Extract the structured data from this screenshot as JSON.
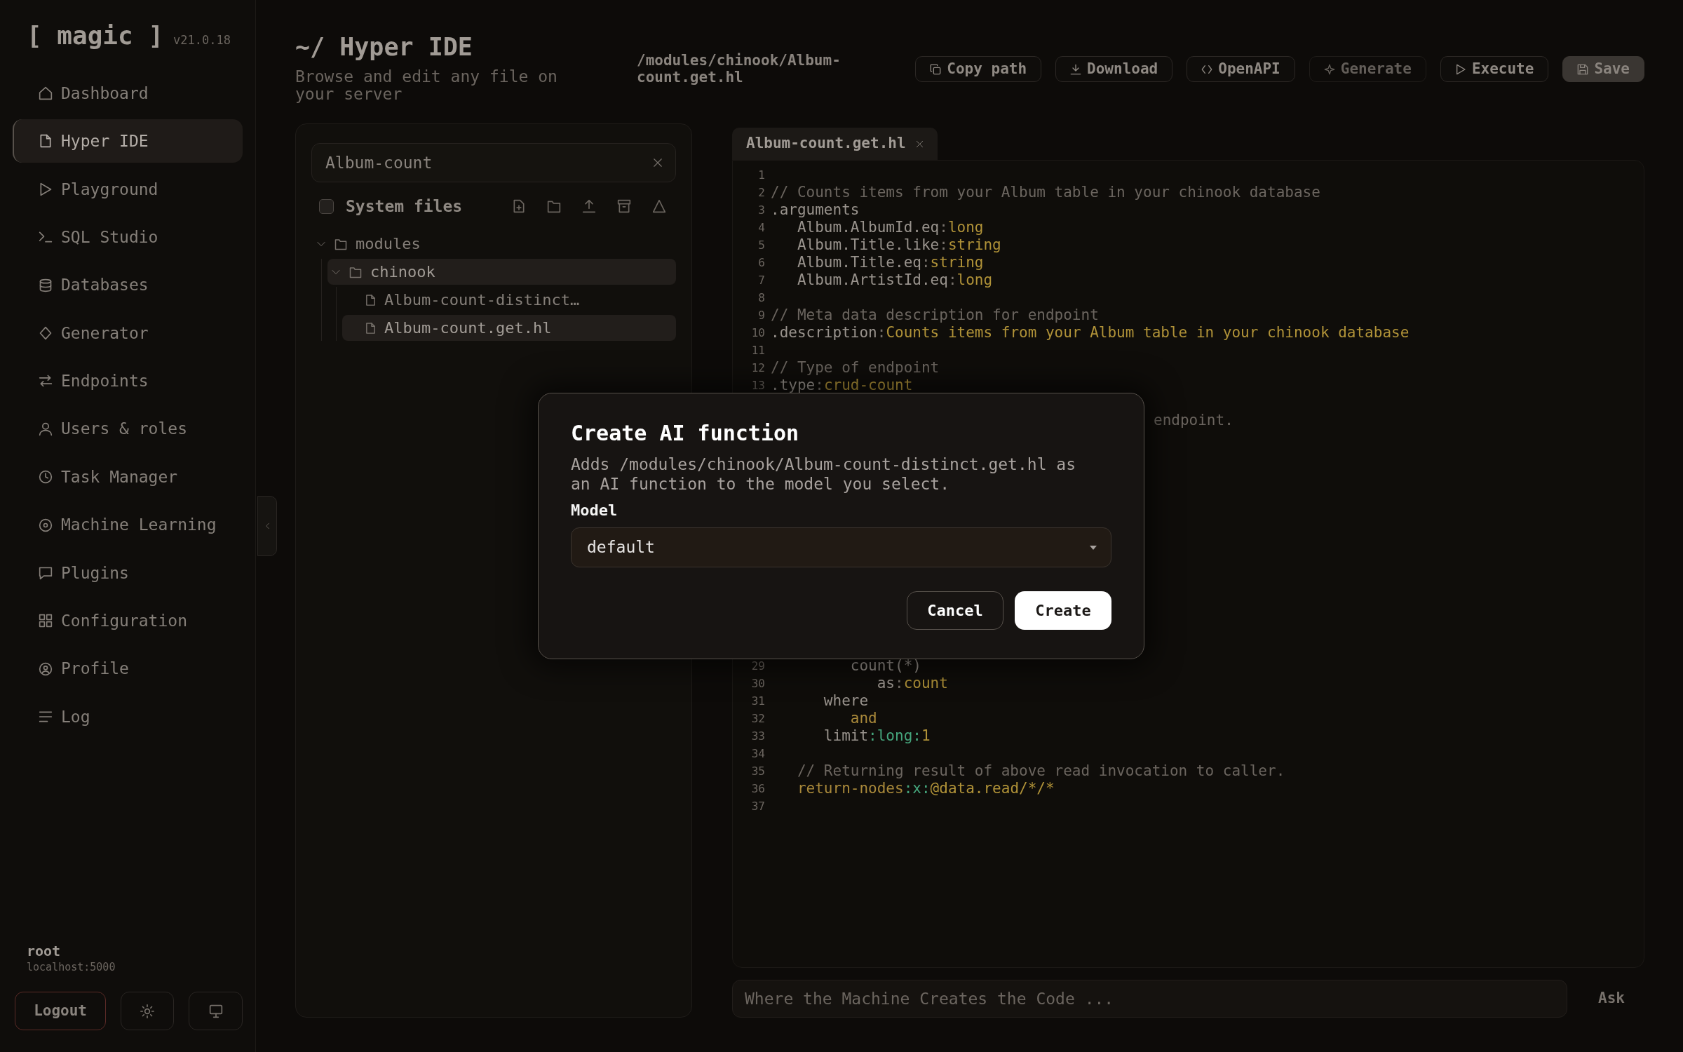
{
  "sidebar": {
    "logo": "[ magic ]",
    "version": "v21.0.18",
    "nav": [
      {
        "label": "Dashboard",
        "selected": false
      },
      {
        "label": "Hyper IDE",
        "selected": true
      },
      {
        "label": "Playground",
        "selected": false
      },
      {
        "label": "SQL Studio",
        "selected": false
      },
      {
        "label": "Databases",
        "selected": false
      },
      {
        "label": "Generator",
        "selected": false
      },
      {
        "label": "Endpoints",
        "selected": false
      },
      {
        "label": "Users & roles",
        "selected": false
      },
      {
        "label": "Task Manager",
        "selected": false
      },
      {
        "label": "Machine Learning",
        "selected": false
      },
      {
        "label": "Plugins",
        "selected": false
      },
      {
        "label": "Configuration",
        "selected": false
      },
      {
        "label": "Profile",
        "selected": false
      },
      {
        "label": "Log",
        "selected": false
      }
    ],
    "user": {
      "name": "root",
      "host": "localhost:5000"
    },
    "logout_button": "Logout"
  },
  "header": {
    "title": "~/ Hyper IDE",
    "subtitle": "Browse and edit any file on your server",
    "path": "/modules/chinook/Album-count.get.hl",
    "actions": [
      {
        "label": "Copy path",
        "kind": "outline",
        "disabled": false
      },
      {
        "label": "Download",
        "kind": "outline",
        "disabled": false
      },
      {
        "label": "OpenAPI",
        "kind": "outline",
        "disabled": false
      },
      {
        "label": "Generate",
        "kind": "outline",
        "disabled": true
      },
      {
        "label": "Execute",
        "kind": "outline",
        "disabled": false
      },
      {
        "label": "Save",
        "kind": "primary",
        "disabled": true
      }
    ]
  },
  "file_panel": {
    "search": {
      "value": "Album-count"
    },
    "system_files": {
      "label": "System files",
      "checked": false
    },
    "tree": [
      {
        "label": "modules",
        "kind": "folder",
        "expanded": true,
        "selected": false,
        "children": [
          {
            "label": "chinook",
            "kind": "folder",
            "expanded": true,
            "selected": true,
            "children": [
              {
                "label": "Album-count-distinct…",
                "kind": "file",
                "selected": false
              },
              {
                "label": "Album-count.get.hl",
                "kind": "file",
                "selected": true
              }
            ]
          }
        ]
      }
    ]
  },
  "editor": {
    "tabs": [
      {
        "label": "Album-count.get.hl",
        "selected": true
      }
    ],
    "lines_above": [
      {
        "number": "1"
      },
      {
        "number": "2",
        "segments": [
          {
            "text": "// Counts items from your Album table in your chinook database",
            "kind": "comment"
          }
        ]
      },
      {
        "number": "3",
        "segments": [
          {
            "text": ".arguments",
            "kind": "key"
          }
        ]
      },
      {
        "number": "4",
        "segments": [
          {
            "text": "   Album.AlbumId.eq",
            "kind": "key"
          },
          {
            "text": ":",
            "kind": "separator"
          },
          {
            "text": "long",
            "kind": "value"
          }
        ]
      },
      {
        "number": "5",
        "segments": [
          {
            "text": "   Album.Title.like",
            "kind": "key"
          },
          {
            "text": ":",
            "kind": "separator"
          },
          {
            "text": "string",
            "kind": "value"
          }
        ]
      },
      {
        "number": "6",
        "segments": [
          {
            "text": "   Album.Title.eq",
            "kind": "key"
          },
          {
            "text": ":",
            "kind": "separator"
          },
          {
            "text": "string",
            "kind": "value"
          }
        ]
      },
      {
        "number": "7",
        "segments": [
          {
            "text": "   Album.ArtistId.eq",
            "kind": "key"
          },
          {
            "text": ":",
            "kind": "separator"
          },
          {
            "text": "long",
            "kind": "value"
          }
        ]
      },
      {
        "number": "8"
      },
      {
        "number": "9",
        "segments": [
          {
            "text": "// Meta data description for endpoint",
            "kind": "comment"
          }
        ]
      },
      {
        "number": "10",
        "segments": [
          {
            "text": ".description",
            "kind": "key"
          },
          {
            "text": ":",
            "kind": "separator"
          },
          {
            "text": "Counts items from your Album table in your chinook database",
            "kind": "value"
          }
        ]
      },
      {
        "number": "11"
      },
      {
        "number": "12",
        "segments": [
          {
            "text": "// Type of endpoint",
            "kind": "comment"
          }
        ]
      },
      {
        "number": "13",
        "segments": [
          {
            "text": ".type",
            "kind": "key"
          },
          {
            "text": ":",
            "kind": "separator"
          },
          {
            "text": "crud-count",
            "kind": "value"
          }
        ]
      }
    ],
    "partial_line": {
      "segments": [
        {
          "text": "endpoint.",
          "kind": "comment"
        }
      ]
    },
    "lines_below": [
      {
        "number": "29",
        "segments": [
          {
            "text": "         count(*)",
            "kind": "key"
          }
        ]
      },
      {
        "number": "30",
        "segments": [
          {
            "text": "            as",
            "kind": "key"
          },
          {
            "text": ":",
            "kind": "separator"
          },
          {
            "text": "count",
            "kind": "value"
          }
        ]
      },
      {
        "number": "31",
        "segments": [
          {
            "text": "      where",
            "kind": "key"
          }
        ]
      },
      {
        "number": "32",
        "segments": [
          {
            "text": "         and",
            "kind": "keyword"
          }
        ]
      },
      {
        "number": "33",
        "segments": [
          {
            "text": "      limit",
            "kind": "key"
          },
          {
            "text": ":long:",
            "kind": "type"
          },
          {
            "text": "1",
            "kind": "value"
          }
        ]
      },
      {
        "number": "34"
      },
      {
        "number": "35",
        "segments": [
          {
            "text": "   // Returning result of above read invocation to caller.",
            "kind": "comment"
          }
        ]
      },
      {
        "number": "36",
        "segments": [
          {
            "text": "   return-nodes",
            "kind": "keyword"
          },
          {
            "text": ":x:",
            "kind": "type"
          },
          {
            "text": "@data.read/*/*",
            "kind": "value"
          }
        ]
      },
      {
        "number": "37"
      }
    ],
    "prompt": {
      "placeholder": "Where the Machine Creates the Code ...",
      "button": "Ask"
    }
  },
  "dialog": {
    "title": "Create AI function",
    "description": "Adds /modules/chinook/Album-count-distinct.get.hl as an AI function to the model you select.",
    "model_label": "Model",
    "model": {
      "value": "default"
    },
    "buttons": [
      {
        "label": "Cancel",
        "kind": "secondary"
      },
      {
        "label": "Create",
        "kind": "primary"
      }
    ]
  }
}
